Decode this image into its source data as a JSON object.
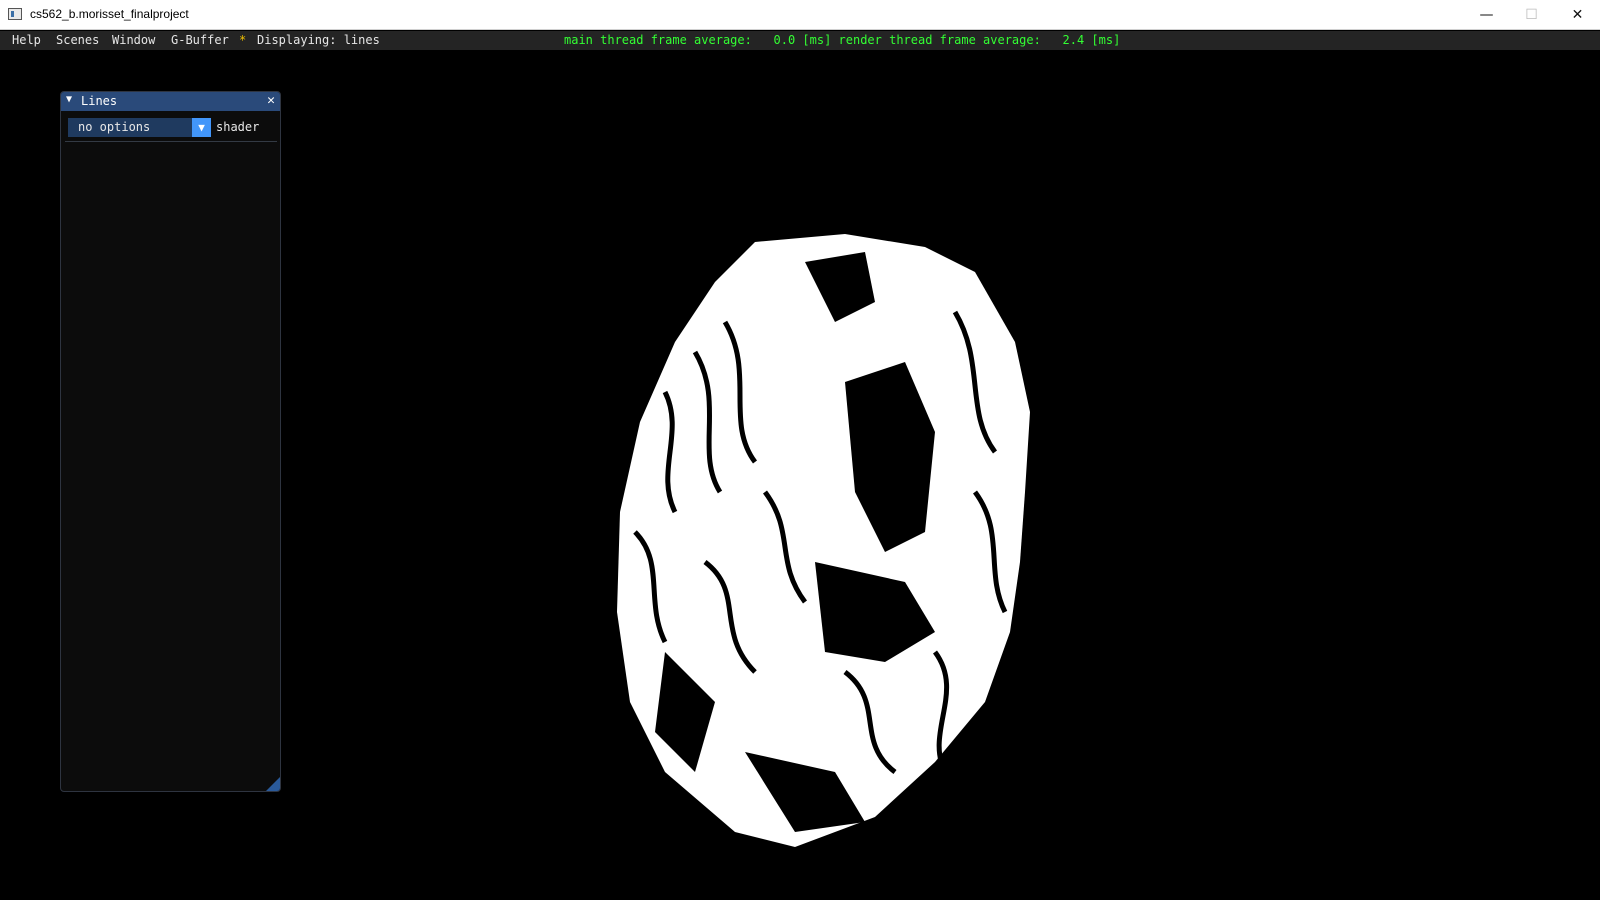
{
  "window": {
    "title": "cs562_b.morisset_finalproject",
    "app_icon": "app-window-icon",
    "controls": {
      "minimize": "—",
      "maximize": "☐",
      "close": "✕"
    }
  },
  "menubar": {
    "items": [
      "Help",
      "Scenes",
      "Window",
      "G-Buffer"
    ],
    "star": "*",
    "displaying": "Displaying: lines",
    "perf": "main thread frame average:   0.0 [ms] render thread frame average:   2.4 [ms]"
  },
  "colors": {
    "menu_bg": "#242424",
    "perf_text": "#33ff33",
    "panel_header": "#2a4a7a",
    "combo_bg": "#1f3a5f",
    "combo_button": "#4296fa",
    "highlight_star": "#f0c000"
  },
  "lines_panel": {
    "title": "Lines",
    "collapse_icon": "▼",
    "close_icon": "✕",
    "combo_value": "no options",
    "combo_arrow": "▼",
    "combo_label": "shader"
  },
  "viewport": {
    "content": "3d-head-render"
  }
}
